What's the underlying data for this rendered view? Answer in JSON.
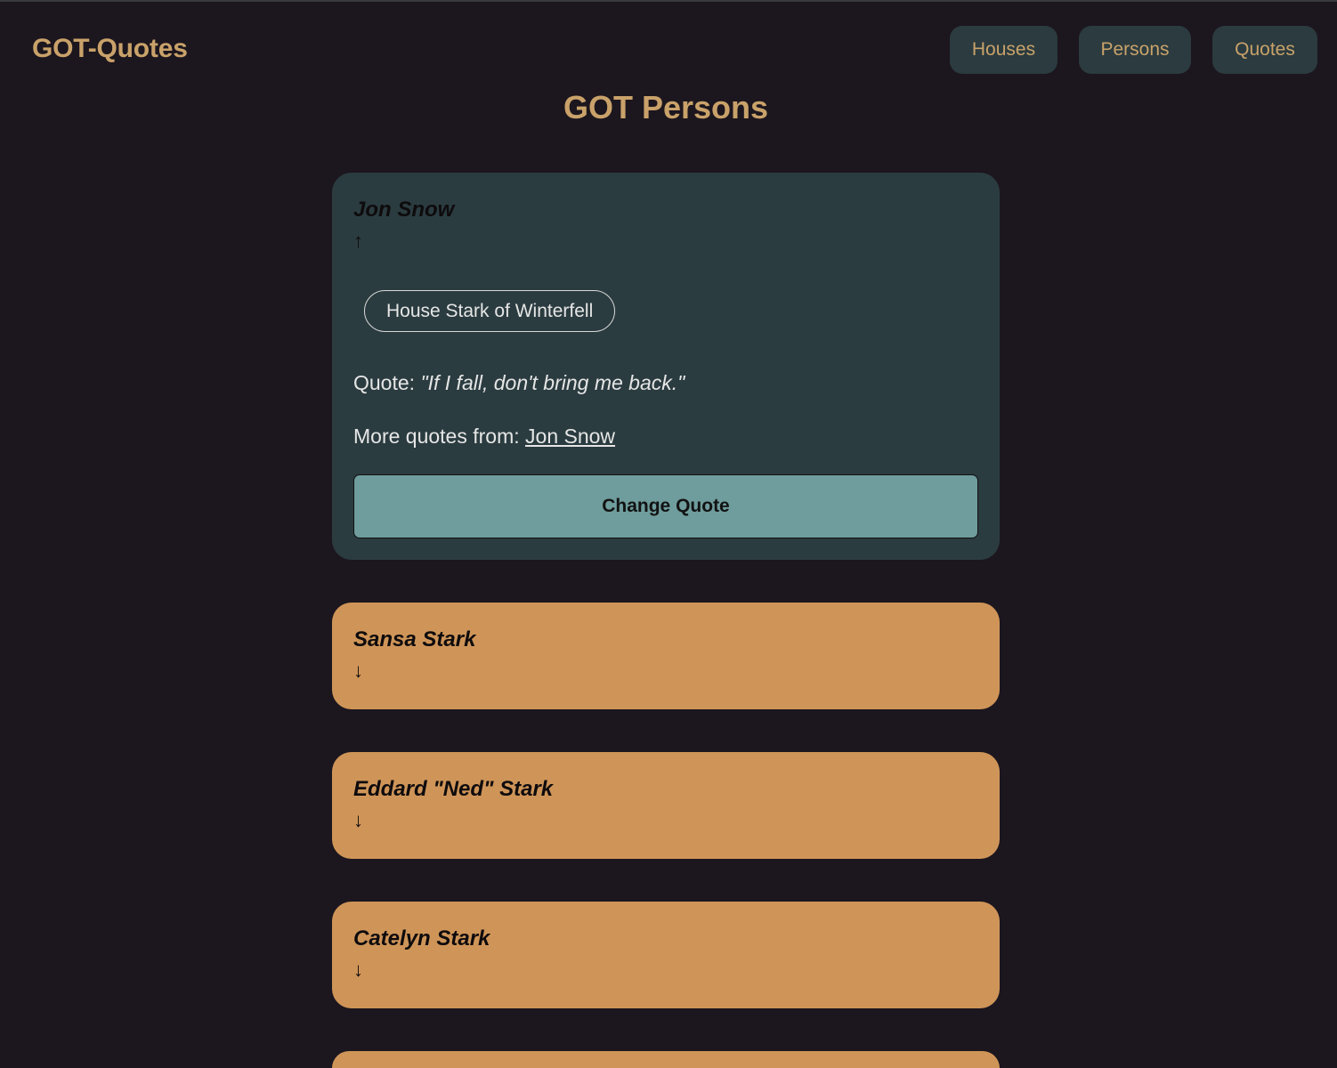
{
  "header": {
    "brand": "GOT-Quotes",
    "nav": [
      {
        "label": "Houses"
      },
      {
        "label": "Persons"
      },
      {
        "label": "Quotes"
      }
    ]
  },
  "page_title": "GOT Persons",
  "open_person": {
    "name": "Jon Snow",
    "arrow": "↑",
    "house": "House Stark of Winterfell",
    "quote_prefix": "Quote: ",
    "quote": "\"If I fall, don't bring me back.\"",
    "more_prefix": "More quotes from: ",
    "more_link": "Jon Snow",
    "change_button": "Change Quote"
  },
  "persons": [
    {
      "name": "Sansa Stark",
      "arrow": "↓"
    },
    {
      "name": "Eddard \"Ned\" Stark",
      "arrow": "↓"
    },
    {
      "name": "Catelyn Stark",
      "arrow": "↓"
    }
  ],
  "colors": {
    "background": "#1c161e",
    "accent": "#c9a26a",
    "open_card": "#2b3c40",
    "closed_card": "#cf9558",
    "button": "#6f9c9c"
  }
}
